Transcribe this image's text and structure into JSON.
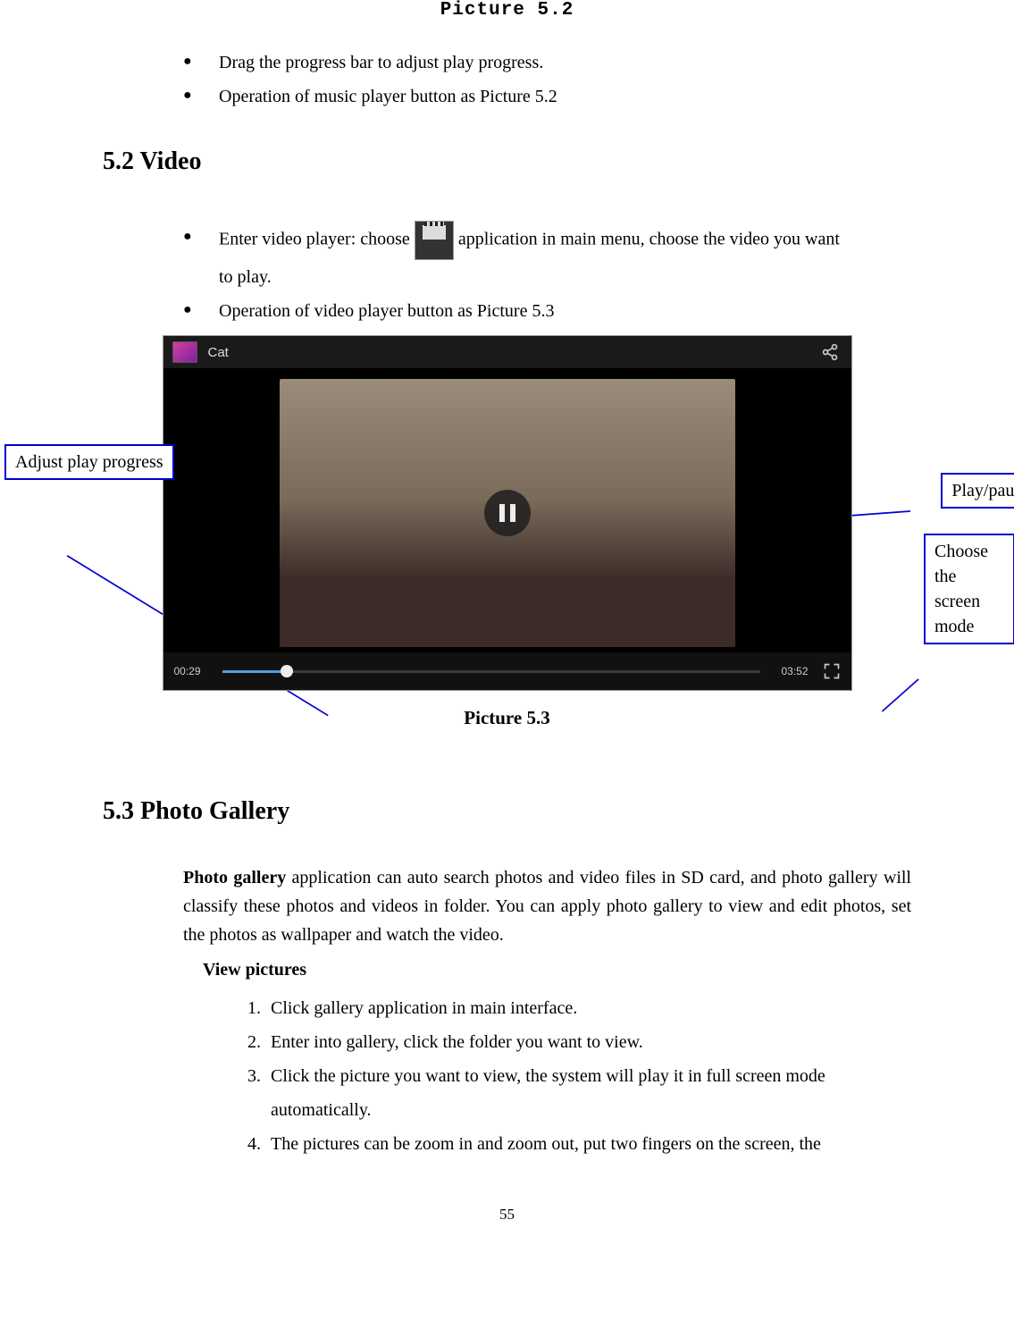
{
  "captions": {
    "top": "Picture 5.2",
    "fig3": "Picture 5.3"
  },
  "top_bullets": [
    "Drag the progress bar to adjust play progress.",
    "Operation of music player button as Picture 5.2"
  ],
  "video_heading": "5.2 Video",
  "video_bullets": {
    "b1a": "Enter video player: choose ",
    "b1b": "application in main menu, choose the video you want",
    "b1c": "to play.",
    "b2": "Operation of video player button as Picture 5.3"
  },
  "video_ui": {
    "title": "Cat",
    "time_current": "00:29",
    "time_total": "03:52"
  },
  "callouts": {
    "adjust": "Adjust play progress",
    "play_pause": "Play/pause",
    "screen_mode": "Choose the screen mode"
  },
  "gallery_heading": "5.3 Photo Gallery",
  "gallery": {
    "intro_bold": "Photo gallery",
    "intro_rest": " application can auto search photos and video files in SD card, and photo gallery will classify these photos and videos in folder. You can apply photo gallery to view and edit photos, set the photos as wallpaper and watch the video.",
    "subhead": "View pictures",
    "steps": [
      "Click gallery application in main interface.",
      "Enter into gallery, click the folder you want to view.",
      "Click the picture you want to view, the system will play it in full screen mode automatically.",
      "The pictures can be zoom in and zoom out, put two fingers on the screen, the"
    ]
  },
  "page_number": "55"
}
